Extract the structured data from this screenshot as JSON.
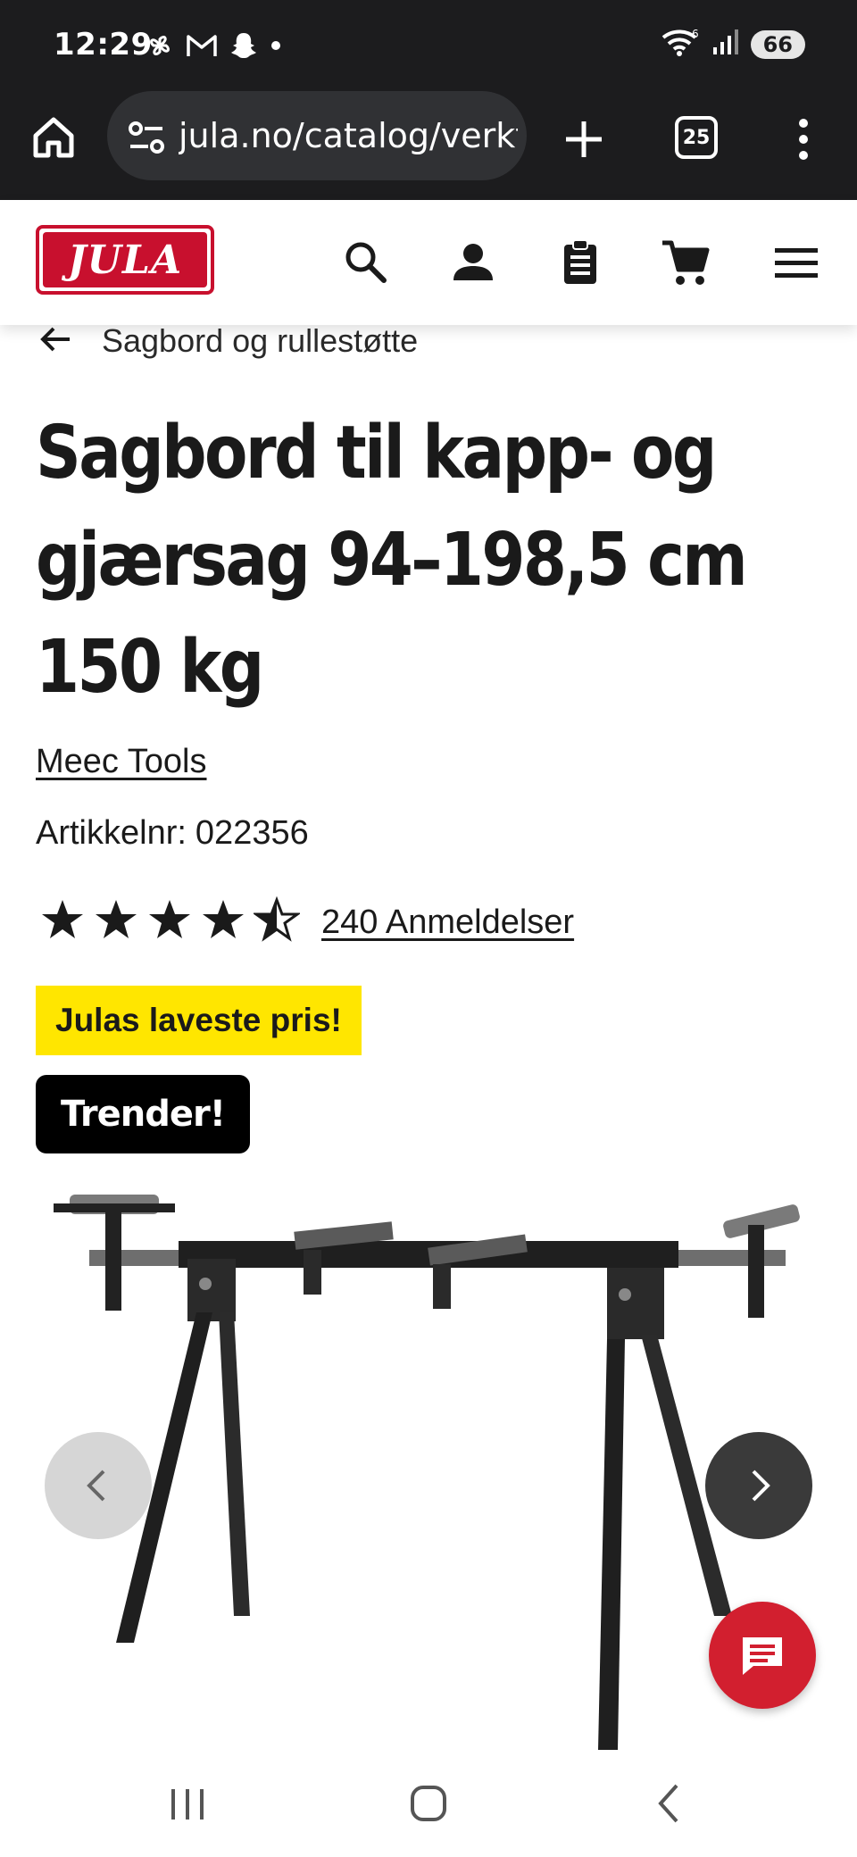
{
  "status_bar": {
    "time": "12:29",
    "notification_icons": [
      "pinwheel-icon",
      "gmail-icon",
      "snapchat-icon",
      "dot-icon"
    ],
    "network": "wifi-6-icon",
    "battery": "66"
  },
  "browser": {
    "url": "jula.no/catalog/verktoy",
    "tab_count": "25"
  },
  "header": {
    "logo_text": "JULA",
    "icons": [
      "search-icon",
      "account-icon",
      "clipboard-list-icon",
      "cart-icon",
      "hamburger-menu-icon"
    ]
  },
  "breadcrumb": {
    "back_label": "Sagbord og rullestøtte"
  },
  "product": {
    "title": "Sagbord til kapp- og gjærsag 94–198,5 cm 150 kg",
    "brand": "Meec Tools",
    "sku_label": "Artikkelnr:",
    "sku": "022356",
    "rating": 4.5,
    "rating_max": 5,
    "reviews_label": "240 Anmeldelser",
    "badge_price": "Julas laveste pris!",
    "badge_trend": "Trender!"
  },
  "colors": {
    "brand_red": "#c8102e",
    "badge_yellow": "#ffe600",
    "chat_red": "#d21f2f"
  }
}
